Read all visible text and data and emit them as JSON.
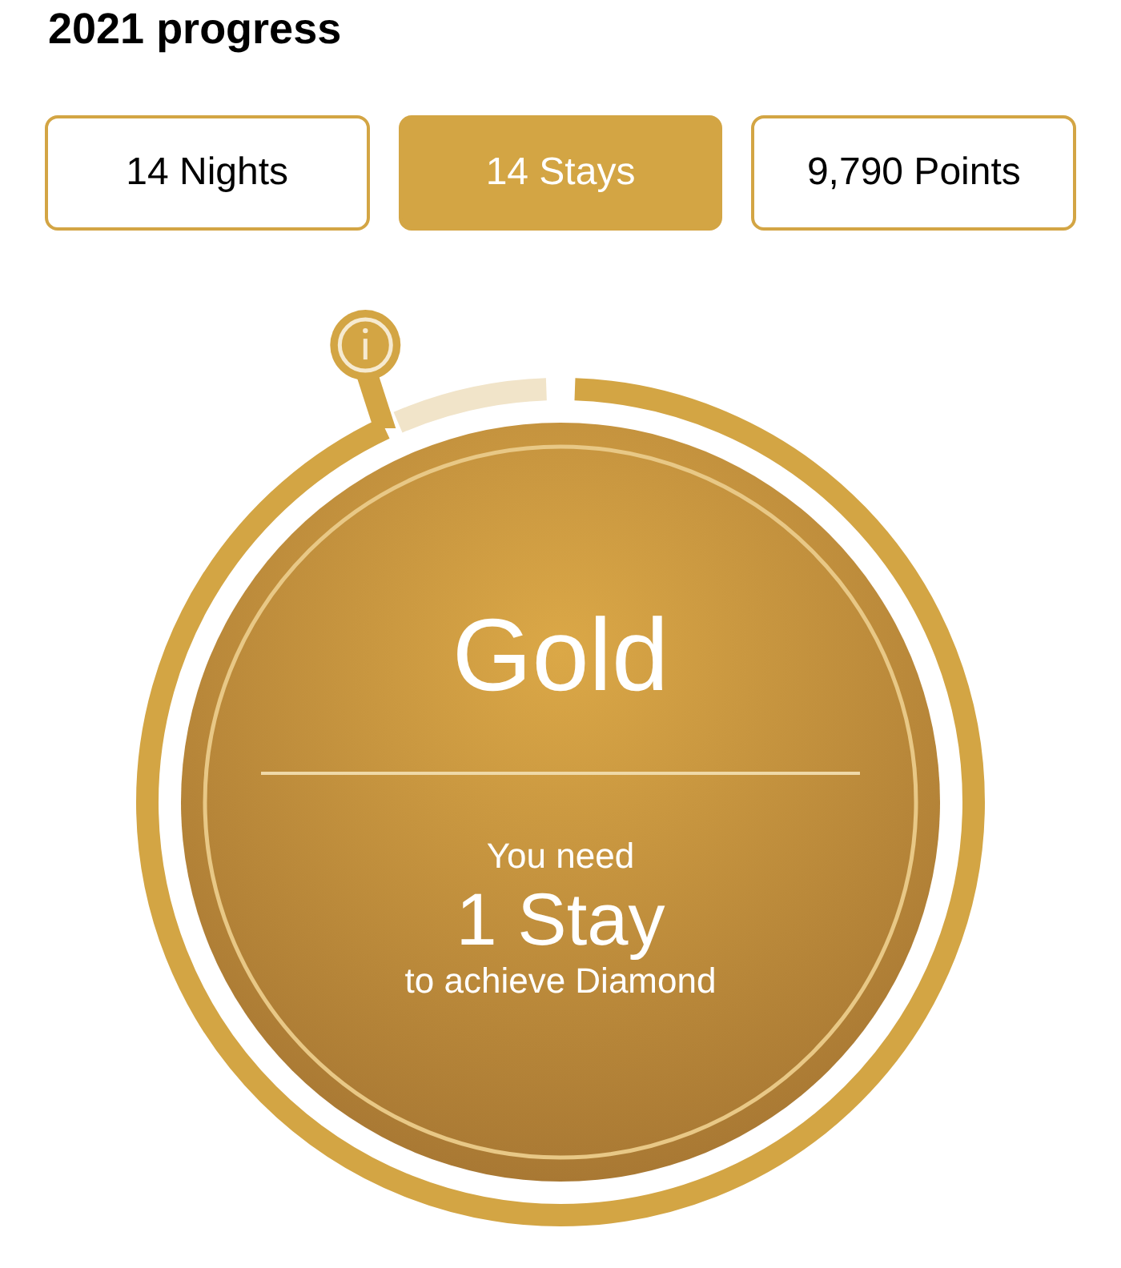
{
  "title": "2021 progress",
  "tabs": [
    {
      "label": "14 Nights",
      "selected": false
    },
    {
      "label": "14 Stays",
      "selected": true
    },
    {
      "label": "9,790 Points",
      "selected": false
    }
  ],
  "progress": {
    "level": 0.93,
    "tier": "Gold",
    "need_label": "You need",
    "need_amount": "1 Stay",
    "target": "to achieve Diamond"
  }
}
